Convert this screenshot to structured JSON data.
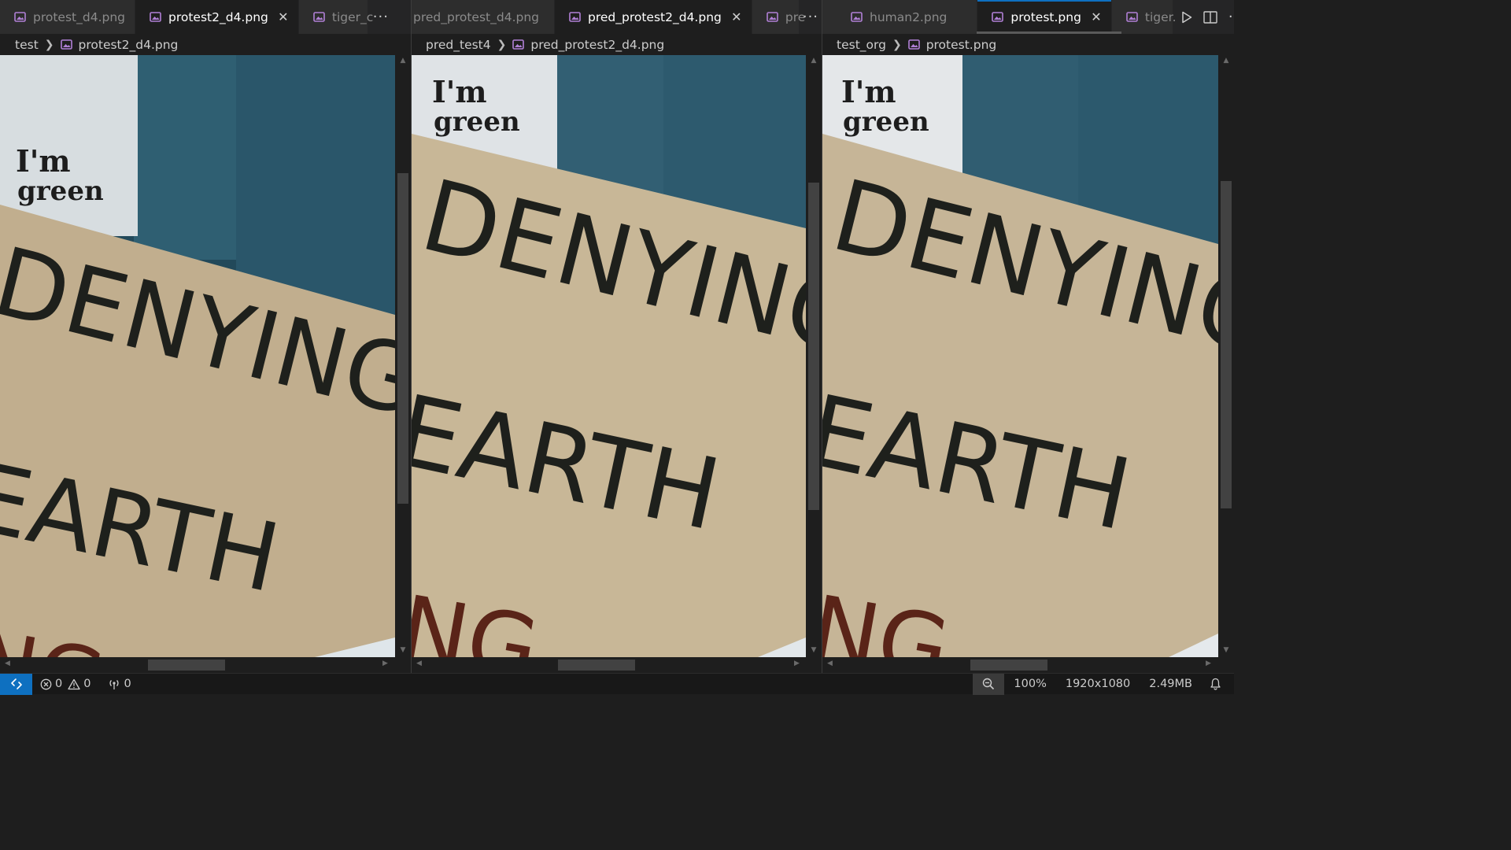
{
  "groups": [
    {
      "tabs": [
        {
          "label": "protest_d4.png",
          "state": "inactive",
          "close": false
        },
        {
          "label": "protest2_d4.png",
          "state": "active",
          "close": true
        },
        {
          "label": "tiger_c",
          "state": "inactive",
          "close": false
        }
      ],
      "breadcrumb": {
        "folder": "test",
        "file": "protest2_d4.png"
      },
      "image_variant": "pixelated"
    },
    {
      "tabs": [
        {
          "label": "pred_protest_d4.png",
          "state": "inactive",
          "close": false
        },
        {
          "label": "pred_protest2_d4.png",
          "state": "active",
          "close": true
        },
        {
          "label": "pre",
          "state": "inactive",
          "close": false
        }
      ],
      "breadcrumb": {
        "folder": "pred_test4",
        "file": "pred_protest2_d4.png"
      },
      "image_variant": "smoothed"
    },
    {
      "tabs": [
        {
          "label": "human2.png",
          "state": "inactive",
          "close": false
        },
        {
          "label": "protest.png",
          "state": "focused",
          "close": true
        },
        {
          "label": "tiger.",
          "state": "inactive",
          "close": false
        }
      ],
      "breadcrumb": {
        "folder": "test_org",
        "file": "protest.png"
      },
      "image_variant": "original"
    }
  ],
  "image": {
    "bag_text_line1": "I'm",
    "bag_text_line2": "green",
    "sign_line1": "DENYING",
    "sign_line2": "EARTH",
    "sign_line3": "NG"
  },
  "tab_actions": {
    "more": "more-actions-icon",
    "run": "run-icon",
    "split": "split-editor-icon"
  },
  "statusbar": {
    "errors": "0",
    "warnings": "0",
    "ports": "0",
    "zoom": "100%",
    "dimensions": "1920x1080",
    "file_size": "2.49MB"
  },
  "colors": {
    "accent": "#0e70c0",
    "image_file_icon": "#b180d7",
    "cardboard": "#c4b394",
    "denim": "#2e5a6e",
    "ink": "#1e201c",
    "red_ink": "#5a2418"
  }
}
